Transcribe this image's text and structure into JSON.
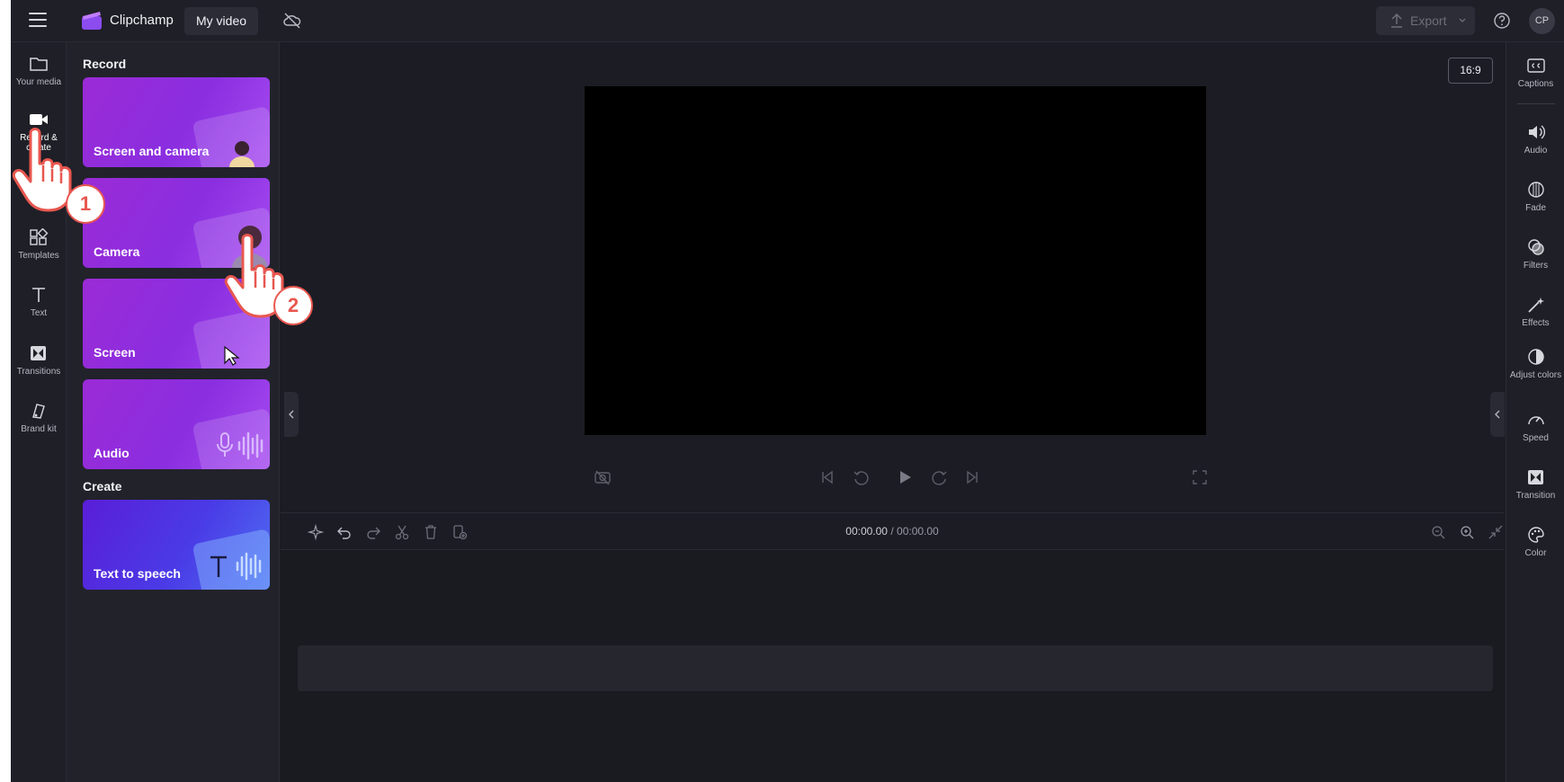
{
  "header": {
    "brand": "Clipchamp",
    "project_title": "My video",
    "export_label": "Export",
    "avatar_initials": "CP"
  },
  "left_rail": {
    "items": [
      {
        "label": "Your media",
        "icon": "folder-icon"
      },
      {
        "label": "Record & create",
        "icon": "video-camera-icon",
        "active": true
      },
      {
        "label": "Templates",
        "icon": "templates-icon"
      },
      {
        "label": "Text",
        "icon": "text-icon"
      },
      {
        "label": "Transitions",
        "icon": "transitions-icon"
      },
      {
        "label": "Brand kit",
        "icon": "brand-kit-icon"
      }
    ]
  },
  "panel": {
    "record_title": "Record",
    "create_title": "Create",
    "cards": [
      {
        "label": "Screen and camera"
      },
      {
        "label": "Camera"
      },
      {
        "label": "Screen"
      },
      {
        "label": "Audio"
      },
      {
        "label": "Text to speech"
      }
    ]
  },
  "preview": {
    "aspect_ratio": "16:9"
  },
  "timeline": {
    "current_time": "00:00.00",
    "separator": "/",
    "total_time": "00:00.00"
  },
  "right_rail": {
    "items": [
      {
        "label": "Captions",
        "icon": "captions-icon"
      },
      {
        "label": "Audio",
        "icon": "speaker-icon"
      },
      {
        "label": "Fade",
        "icon": "fade-icon"
      },
      {
        "label": "Filters",
        "icon": "filters-icon"
      },
      {
        "label": "Effects",
        "icon": "magic-wand-icon"
      },
      {
        "label": "Adjust colors",
        "icon": "adjust-colors-icon"
      },
      {
        "label": "Speed",
        "icon": "speedometer-icon"
      },
      {
        "label": "Transition",
        "icon": "transition-icon"
      },
      {
        "label": "Color",
        "icon": "palette-icon"
      }
    ]
  },
  "annotations": {
    "step1": "1",
    "step2": "2"
  },
  "colors": {
    "background": "#1c1c24",
    "card_purple": "#9b2bd6",
    "card_blue": "#4a3be6",
    "badge_red": "#e8574f"
  }
}
